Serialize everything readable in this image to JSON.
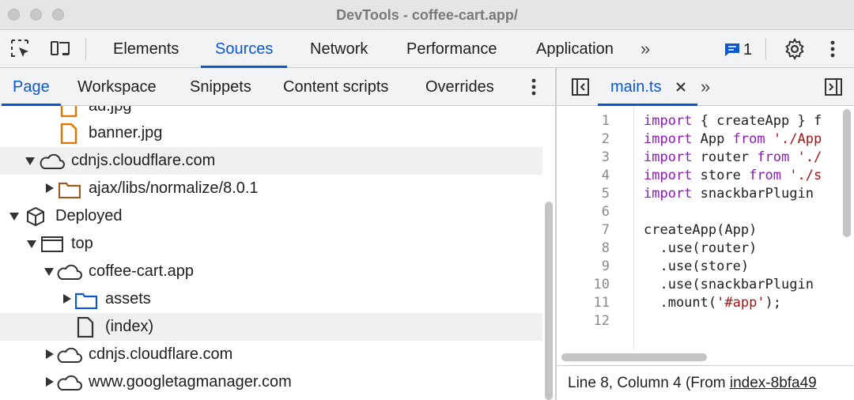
{
  "window": {
    "title": "DevTools - coffee-cart.app/"
  },
  "toolbar": {
    "tabs": [
      "Elements",
      "Sources",
      "Network",
      "Performance",
      "Application"
    ],
    "active_tab": "Sources",
    "more": "»",
    "issues_count": "1"
  },
  "navigator": {
    "tabs": [
      "Page",
      "Workspace",
      "Snippets",
      "Content scripts",
      "Overrides"
    ],
    "active_tab": "Page",
    "tree": [
      {
        "label": "ad.jpg",
        "icon": "file-image-icon"
      },
      {
        "label": "banner.jpg",
        "icon": "file-image-icon"
      },
      {
        "label": "cdnjs.cloudflare.com",
        "icon": "cloud-icon"
      },
      {
        "label": "ajax/libs/normalize/8.0.1",
        "icon": "folder-icon"
      },
      {
        "label": "Deployed",
        "icon": "cube-icon"
      },
      {
        "label": "top",
        "icon": "frame-icon"
      },
      {
        "label": "coffee-cart.app",
        "icon": "cloud-icon"
      },
      {
        "label": "assets",
        "icon": "folder-icon"
      },
      {
        "label": "(index)",
        "icon": "file-icon"
      },
      {
        "label": "cdnjs.cloudflare.com",
        "icon": "cloud-icon"
      },
      {
        "label": "www.googletagmanager.com",
        "icon": "cloud-icon"
      }
    ]
  },
  "editor": {
    "file_tab": "main.ts",
    "line_numbers": [
      "1",
      "2",
      "3",
      "4",
      "5",
      "6",
      "7",
      "8",
      "9",
      "10",
      "11",
      "12"
    ],
    "lines": [
      {
        "kw": "import",
        "rest": " { createApp } f"
      },
      {
        "kw": "import",
        "rest": " App from './App"
      },
      {
        "kw": "import",
        "rest": " router from './"
      },
      {
        "kw": "import",
        "rest": " store from './s"
      },
      {
        "kw": "import",
        "rest": " snackbarPlugin "
      },
      {
        "kw": "",
        "rest": ""
      },
      {
        "kw": "",
        "rest": "createApp(App)"
      },
      {
        "kw": "",
        "rest": "  .use(router)"
      },
      {
        "kw": "",
        "rest": "  .use(store)"
      },
      {
        "kw": "",
        "rest": "  .use(snackbarPlugin"
      },
      {
        "kw": "",
        "rest": "  .mount('#app');"
      },
      {
        "kw": "",
        "rest": ""
      }
    ],
    "status": {
      "position": "Line 8, Column 4",
      "from_prefix": "(From",
      "from_link": "index-8bfa49"
    }
  },
  "colors": {
    "accent": "#0b57d0",
    "keyword": "#8c1ab5",
    "string": "#a31515"
  }
}
